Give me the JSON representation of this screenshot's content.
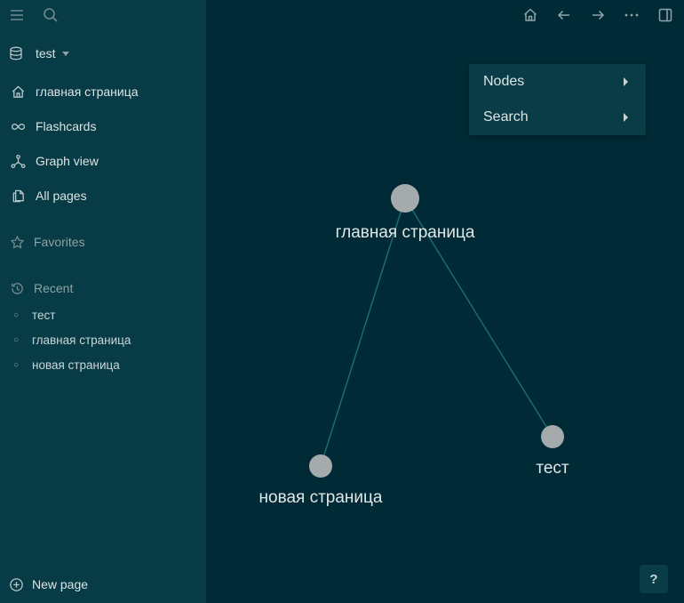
{
  "sidebar": {
    "db_name": "test",
    "items": [
      {
        "label": "главная страница",
        "icon": "home-icon"
      },
      {
        "label": "Flashcards",
        "icon": "infinity-icon"
      },
      {
        "label": "Graph view",
        "icon": "graph-icon"
      },
      {
        "label": "All pages",
        "icon": "pages-icon"
      }
    ],
    "favorites_label": "Favorites",
    "recent_label": "Recent",
    "recent": [
      "тест",
      "главная страница",
      "новая страница"
    ],
    "new_page_label": "New page"
  },
  "menu": {
    "items": [
      {
        "label": "Nodes"
      },
      {
        "label": "Search"
      }
    ]
  },
  "graph": {
    "nodes": [
      {
        "label": "главная страница"
      },
      {
        "label": "новая страница"
      },
      {
        "label": "тест"
      }
    ]
  },
  "help_label": "?",
  "colors": {
    "sidebar_bg": "#073b45",
    "main_bg": "#002b36",
    "node_fill": "#a5aaac",
    "edge": "#1f6c75"
  }
}
